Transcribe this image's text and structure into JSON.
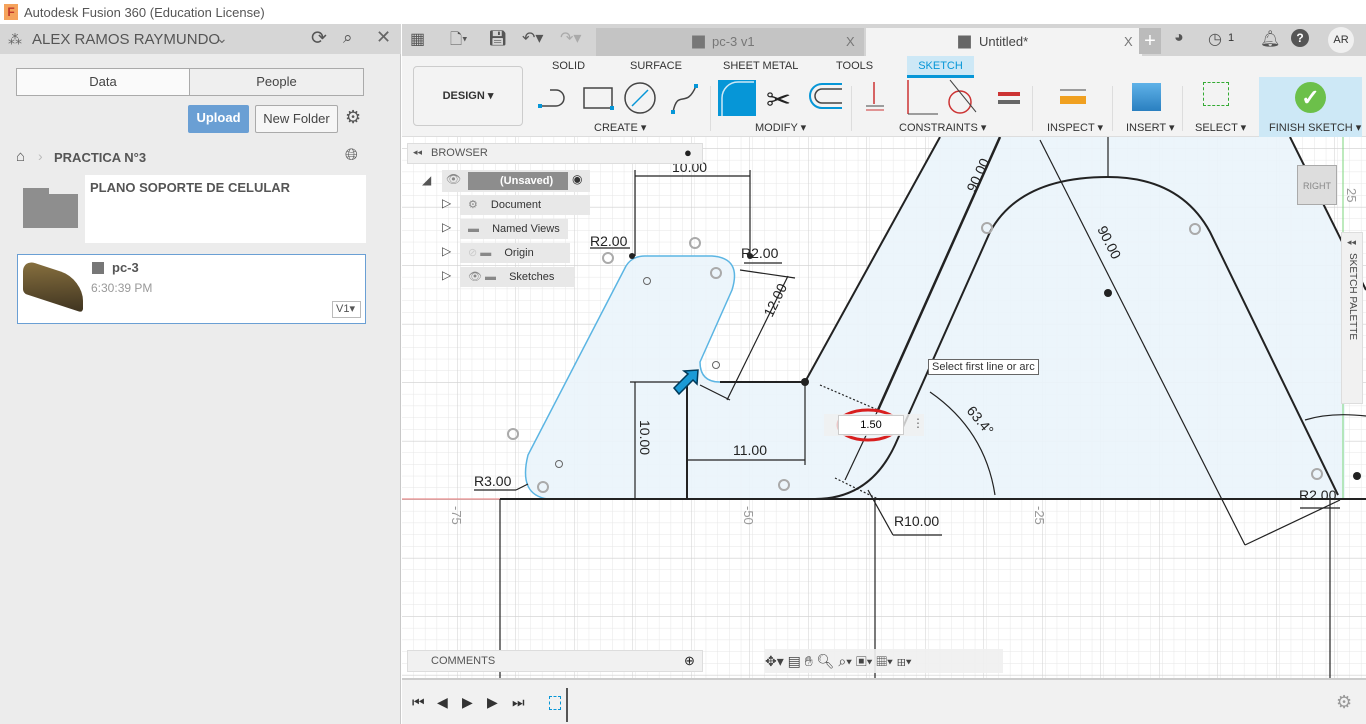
{
  "window": {
    "title": "Autodesk Fusion 360 (Education License)",
    "logo": "F"
  },
  "data_panel": {
    "user": "ALEX RAMOS RAYMUNDO",
    "tabs": [
      "Data",
      "People"
    ],
    "upload_label": "Upload",
    "new_folder_label": "New Folder",
    "breadcrumb": "PRACTICA N°3",
    "items": [
      {
        "name": "PLANO SOPORTE DE CELULAR",
        "type": "folder"
      },
      {
        "name": "pc-3",
        "time": "6:30:39 PM",
        "version": "V1"
      }
    ]
  },
  "doc_tabs": [
    {
      "label": "pc-3 v1",
      "active": false
    },
    {
      "label": "Untitled*",
      "active": true
    }
  ],
  "header_right": {
    "jobs_count": "1",
    "avatar": "AR"
  },
  "ribbon": {
    "workspace": "DESIGN",
    "tabs": [
      "SOLID",
      "SURFACE",
      "SHEET METAL",
      "TOOLS",
      "SKETCH"
    ],
    "active_tab": "SKETCH",
    "groups": [
      "CREATE",
      "MODIFY",
      "CONSTRAINTS",
      "INSPECT",
      "INSERT",
      "SELECT",
      "FINISH SKETCH"
    ]
  },
  "browser": {
    "title": "BROWSER",
    "root": "(Unsaved)",
    "items": [
      "Document Settings",
      "Named Views",
      "Origin",
      "Sketches"
    ]
  },
  "comments": {
    "title": "COMMENTS"
  },
  "sketch_palette": {
    "title": "SKETCH PALETTE"
  },
  "view_cube": {
    "face": "RIGHT"
  },
  "sketch": {
    "dimensions": {
      "top_width": "10.00",
      "slot_length": "12.00",
      "left_height": "10.00",
      "inner_width": "11.00",
      "radius_left": "R3.00",
      "radius_top_left": "R2.00",
      "radius_top_right": "R2.00",
      "radius_arc": "R10.00",
      "radius_right": "R2.00",
      "angle": "63.4°",
      "leg_length_1": "90.00",
      "leg_length_2": "90.00"
    },
    "axis_labels": {
      "x1": "-75",
      "x2": "-50",
      "x3": "-25",
      "y1": "25"
    },
    "tooltip": "Select first line or arc",
    "input_value": "1.50"
  },
  "colors": {
    "accent": "#0696d7",
    "finish": "#6cc04a",
    "sketch_fill": "#eaf4fb",
    "profile": "#5bb5e3",
    "upload": "#6a9fd4"
  }
}
